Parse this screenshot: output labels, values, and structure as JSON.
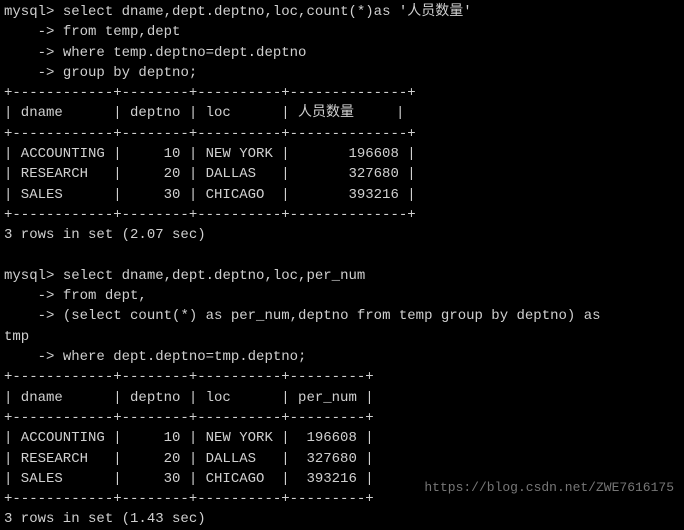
{
  "query1": {
    "prompt": "mysql>",
    "cont": "    ->",
    "lines": [
      " select dname,dept.deptno,loc,count(*)as '人员数量'",
      " from temp,dept",
      " where temp.deptno=dept.deptno",
      " group by deptno;"
    ],
    "border1": "+------------+--------+----------+--------------+",
    "header": "| dname      | deptno | loc      | 人员数量     |",
    "border2": "+------------+--------+----------+--------------+",
    "rows": [
      "| ACCOUNTING |     10 | NEW YORK |       196608 |",
      "| RESEARCH   |     20 | DALLAS   |       327680 |",
      "| SALES      |     30 | CHICAGO  |       393216 |"
    ],
    "border3": "+------------+--------+----------+--------------+",
    "status": "3 rows in set (2.07 sec)"
  },
  "query2": {
    "prompt": "mysql>",
    "cont": "    ->",
    "lines": [
      " select dname,dept.deptno,loc,per_num",
      " from dept,",
      " (select count(*) as per_num,deptno from temp group by deptno) as ",
      " where dept.deptno=tmp.deptno;"
    ],
    "tmp": "tmp",
    "border1": "+------------+--------+----------+---------+",
    "header": "| dname      | deptno | loc      | per_num |",
    "border2": "+------------+--------+----------+---------+",
    "rows": [
      "| ACCOUNTING |     10 | NEW YORK |  196608 |",
      "| RESEARCH   |     20 | DALLAS   |  327680 |",
      "| SALES      |     30 | CHICAGO  |  393216 |"
    ],
    "border3": "+------------+--------+----------+---------+",
    "status": "3 rows in set (1.43 sec)"
  },
  "chart_data": [
    {
      "type": "table",
      "title": "Query 1 Result",
      "columns": [
        "dname",
        "deptno",
        "loc",
        "人员数量"
      ],
      "rows": [
        [
          "ACCOUNTING",
          10,
          "NEW YORK",
          196608
        ],
        [
          "RESEARCH",
          20,
          "DALLAS",
          327680
        ],
        [
          "SALES",
          30,
          "CHICAGO",
          393216
        ]
      ]
    },
    {
      "type": "table",
      "title": "Query 2 Result",
      "columns": [
        "dname",
        "deptno",
        "loc",
        "per_num"
      ],
      "rows": [
        [
          "ACCOUNTING",
          10,
          "NEW YORK",
          196608
        ],
        [
          "RESEARCH",
          20,
          "DALLAS",
          327680
        ],
        [
          "SALES",
          30,
          "CHICAGO",
          393216
        ]
      ]
    }
  ],
  "watermark": "https://blog.csdn.net/ZWE7616175"
}
